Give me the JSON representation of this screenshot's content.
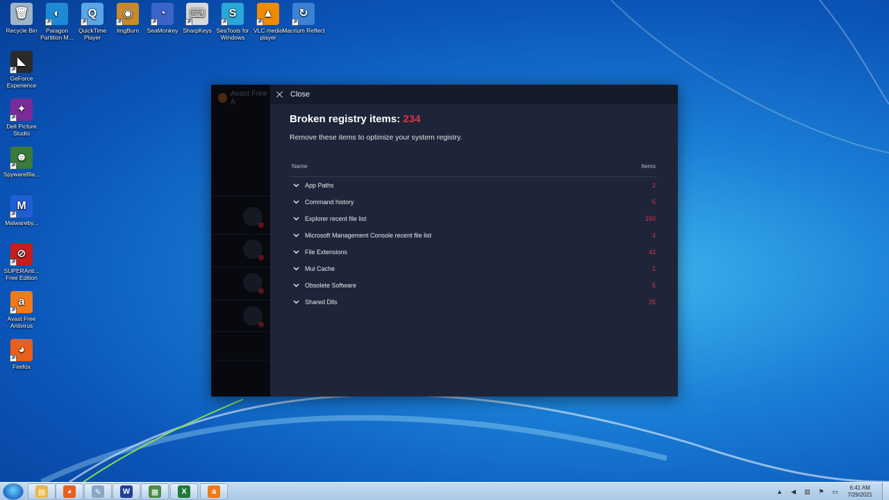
{
  "desktop": {
    "icons": [
      {
        "label": "Recycle Bin",
        "icon": "recycle-bin-icon",
        "color": "#9fb4c8",
        "glyph": "🗑"
      },
      {
        "label": "Paragon Partition M...",
        "icon": "paragon-icon",
        "color": "#1e8ad6",
        "glyph": "◐"
      },
      {
        "label": "QuickTime Player",
        "icon": "quicktime-icon",
        "color": "#5aa5e6",
        "glyph": "Q"
      },
      {
        "label": "ImgBurn",
        "icon": "imgburn-icon",
        "color": "#c98a2a",
        "glyph": "◉"
      },
      {
        "label": "SeaMonkey",
        "icon": "seamonkey-icon",
        "color": "#3b64c8",
        "glyph": "◔"
      },
      {
        "label": "SharpKeys",
        "icon": "sharpkeys-icon",
        "color": "#d9d9d9",
        "glyph": "⌨"
      },
      {
        "label": "SeaTools for Windows",
        "icon": "seatools-icon",
        "color": "#2aa8d8",
        "glyph": "S"
      },
      {
        "label": "VLC media player",
        "icon": "vlc-icon",
        "color": "#f08a00",
        "glyph": "▲"
      },
      {
        "label": "Macrium Reflect",
        "icon": "macrium-icon",
        "color": "#3b82d6",
        "glyph": "↻"
      },
      {
        "label": "GeForce Experience",
        "icon": "geforce-icon",
        "color": "#2b2b2b",
        "glyph": "◣"
      },
      {
        "label": "Dell Picture Studio",
        "icon": "dell-picture-icon",
        "color": "#7a2b9a",
        "glyph": "✦"
      },
      {
        "label": "SpywareBla...",
        "icon": "spywareblaster-icon",
        "color": "#3a7a3a",
        "glyph": "☻"
      },
      {
        "label": "Malwareby...",
        "icon": "malwarebytes-icon",
        "color": "#1f5fd6",
        "glyph": "M"
      },
      {
        "label": "SUPERAnti... Free Edition",
        "icon": "superantispyware-icon",
        "color": "#c41e1e",
        "glyph": "⊘"
      },
      {
        "label": "Avast Free Antivirus",
        "icon": "avast-icon",
        "color": "#f07a1a",
        "glyph": "a"
      },
      {
        "label": "Firefox",
        "icon": "firefox-icon",
        "color": "#e8601c",
        "glyph": "◕"
      }
    ]
  },
  "avast": {
    "ghost_title": "Avast Free A",
    "close_label": "Close",
    "heading": "Broken registry items: ",
    "heading_count": "234",
    "subtitle": "Remove these items to optimize your system registry.",
    "col_name": "Name",
    "col_items": "Items",
    "rows": [
      {
        "name": "App Paths",
        "count": "2"
      },
      {
        "name": "Command history",
        "count": "5"
      },
      {
        "name": "Explorer recent file list",
        "count": "150"
      },
      {
        "name": "Microsoft Management Console recent file list",
        "count": "4"
      },
      {
        "name": "File Extensions",
        "count": "42"
      },
      {
        "name": "Mui Cache",
        "count": "1"
      },
      {
        "name": "Obsolete Software",
        "count": "5"
      },
      {
        "name": "Shared Dlls",
        "count": "25"
      }
    ],
    "accent_color": "#e0314a"
  },
  "taskbar": {
    "apps": [
      {
        "name": "explorer",
        "icon": "folder-icon",
        "color": "#e8b84a",
        "glyph": "▤"
      },
      {
        "name": "firefox",
        "icon": "firefox-icon",
        "color": "#e8601c",
        "glyph": "◕"
      },
      {
        "name": "paint",
        "icon": "paint-icon",
        "color": "#8aa6c8",
        "glyph": "✎"
      },
      {
        "name": "word",
        "icon": "word-icon",
        "color": "#1f3f99",
        "glyph": "W"
      },
      {
        "name": "control-panel",
        "icon": "control-panel-icon",
        "color": "#4a8a4a",
        "glyph": "▦"
      },
      {
        "name": "excel",
        "icon": "excel-icon",
        "color": "#1d7a3a",
        "glyph": "X"
      },
      {
        "name": "avast",
        "icon": "avast-icon",
        "color": "#f07a1a",
        "glyph": "a"
      }
    ],
    "clock_time": "6:41 AM",
    "clock_date": "7/29/2021"
  }
}
